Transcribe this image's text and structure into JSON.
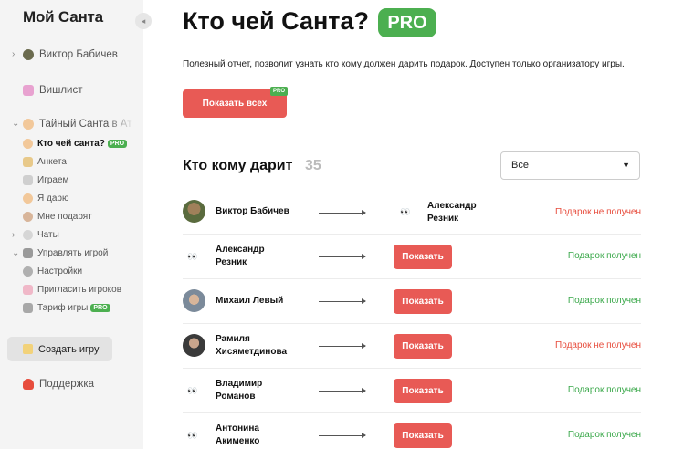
{
  "sidebar": {
    "logo": "Мой Санта",
    "collapse_icon": "◂",
    "items": [
      {
        "label": "Виктор Бабичев",
        "icon": "avatar-icon"
      },
      {
        "label": "Вишлист",
        "icon": "gift-icon"
      },
      {
        "label": "Тайный Санта в Ат",
        "icon": "santa-icon"
      },
      {
        "label": "Кто чей санта?",
        "icon": "santa-face-icon",
        "badge": "PRO"
      },
      {
        "label": "Анкета",
        "icon": "form-icon"
      },
      {
        "label": "Играем",
        "icon": "dice-icon"
      },
      {
        "label": "Я дарю",
        "icon": "santa-face-icon"
      },
      {
        "label": "Мне подарят",
        "icon": "person-icon"
      },
      {
        "label": "Чаты",
        "icon": "chat-icon"
      },
      {
        "label": "Управлять игрой",
        "icon": "grid-icon"
      },
      {
        "label": "Настройки",
        "icon": "gear-icon"
      },
      {
        "label": "Пригласить игроков",
        "icon": "envelope-icon"
      },
      {
        "label": "Тариф игры",
        "icon": "cart-icon",
        "badge": "PRO"
      }
    ],
    "create_label": "Создать игру",
    "support_label": "Поддержка"
  },
  "main": {
    "title": "Кто чей Санта?",
    "pro_badge": "PRO",
    "description": "Полезный отчет, позволит узнать кто кому должен дарить подарок. Доступен только организатору игры.",
    "show_all_label": "Показать всех",
    "show_all_tag": "PRO",
    "section_title": "Кто кому дарит",
    "section_count": "35",
    "filter_value": "Все",
    "filter_chevron": "▼",
    "eyes_glyph": "👀",
    "show_label": "Показать",
    "rows": [
      {
        "giver_line1": "Виктор Бабичев",
        "giver_line2": "",
        "target_line1": "Александр",
        "target_line2": "Резник",
        "status": "Подарок не получен",
        "status_kind": "bad"
      },
      {
        "giver_line1": "Александр",
        "giver_line2": "Резник",
        "status": "Подарок получен",
        "status_kind": "good"
      },
      {
        "giver_line1": "Михаил Левый",
        "giver_line2": "",
        "status": "Подарок получен",
        "status_kind": "good"
      },
      {
        "giver_line1": "Рамиля",
        "giver_line2": "Хисяметдинова",
        "status": "Подарок не получен",
        "status_kind": "bad"
      },
      {
        "giver_line1": "Владимир",
        "giver_line2": "Романов",
        "status": "Подарок получен",
        "status_kind": "good"
      },
      {
        "giver_line1": "Антонина",
        "giver_line2": "Акименко",
        "status": "Подарок получен",
        "status_kind": "good"
      }
    ]
  },
  "colors": {
    "accent_red": "#e85a55",
    "pro_green": "#4caf50",
    "status_bad": "#e74c3c",
    "status_good": "#3aa84a"
  }
}
